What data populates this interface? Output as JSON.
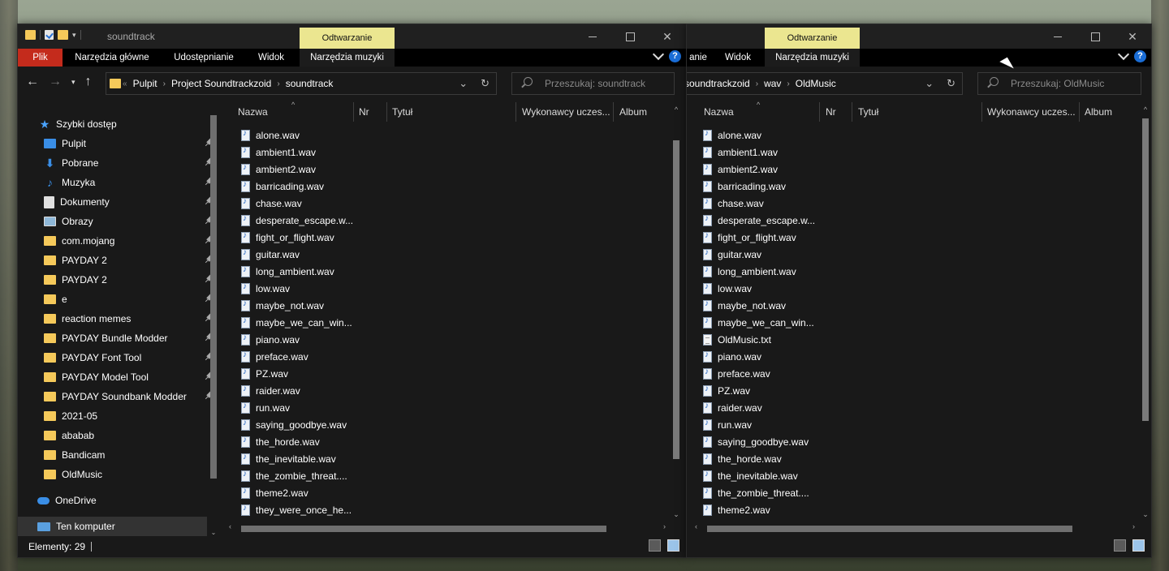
{
  "colors": {
    "file_tab": "#c42b1c",
    "context_tab": "#ebe690",
    "window_bg": "#191919",
    "accent": "#1a6dd6",
    "folder": "#f5c95a"
  },
  "window1": {
    "title": "soundtrack",
    "context_tab": "Odtwarzanie",
    "ribbon_tabs": [
      "Plik",
      "Narzędzia główne",
      "Udostępnianie",
      "Widok",
      "Narzędzia muzyki"
    ],
    "breadcrumb": [
      "Pulpit",
      "Project Soundtrackzoid",
      "soundtrack"
    ],
    "search_placeholder": "Przeszukaj: soundtrack",
    "columns": [
      "Nazwa",
      "Nr",
      "Tytuł",
      "Wykonawcy uczes...",
      "Album"
    ],
    "nav": {
      "quick_access": "Szybki dostęp",
      "items": [
        {
          "label": "Pulpit",
          "icon": "desktop-icon",
          "pinned": true
        },
        {
          "label": "Pobrane",
          "icon": "download-icon",
          "pinned": true
        },
        {
          "label": "Muzyka",
          "icon": "music-icon",
          "pinned": true
        },
        {
          "label": "Dokumenty",
          "icon": "documents-icon",
          "pinned": true
        },
        {
          "label": "Obrazy",
          "icon": "pictures-icon",
          "pinned": true
        },
        {
          "label": "com.mojang",
          "icon": "folder-icon",
          "pinned": true
        },
        {
          "label": "PAYDAY 2",
          "icon": "folder-icon",
          "pinned": true
        },
        {
          "label": "PAYDAY 2",
          "icon": "folder-icon",
          "pinned": true
        },
        {
          "label": "e",
          "icon": "folder-icon",
          "pinned": true
        },
        {
          "label": "reaction memes",
          "icon": "folder-icon",
          "pinned": true
        },
        {
          "label": "PAYDAY Bundle Modder",
          "icon": "folder-icon",
          "pinned": true
        },
        {
          "label": "PAYDAY Font Tool",
          "icon": "folder-icon",
          "pinned": true
        },
        {
          "label": "PAYDAY Model Tool",
          "icon": "folder-icon",
          "pinned": true
        },
        {
          "label": "PAYDAY Soundbank Modder",
          "icon": "folder-icon",
          "pinned": true
        },
        {
          "label": "2021-05",
          "icon": "folder-icon",
          "pinned": false
        },
        {
          "label": "ababab",
          "icon": "folder-icon",
          "pinned": false
        },
        {
          "label": "Bandicam",
          "icon": "folder-icon",
          "pinned": false
        },
        {
          "label": "OldMusic",
          "icon": "folder-icon",
          "pinned": false
        }
      ],
      "onedrive": "OneDrive",
      "this_pc": "Ten komputer"
    },
    "files": [
      "alone.wav",
      "ambient1.wav",
      "ambient2.wav",
      "barricading.wav",
      "chase.wav",
      "desperate_escape.w...",
      "fight_or_flight.wav",
      "guitar.wav",
      "long_ambient.wav",
      "low.wav",
      "maybe_not.wav",
      "maybe_we_can_win...",
      "piano.wav",
      "preface.wav",
      "PZ.wav",
      "raider.wav",
      "run.wav",
      "saying_goodbye.wav",
      "the_horde.wav",
      "the_inevitable.wav",
      "the_zombie_threat....",
      "theme2.wav",
      "they_were_once_he..."
    ],
    "status": "Elementy: 29"
  },
  "window2": {
    "context_tab": "Odtwarzanie",
    "ribbon_tabs": [
      "anie",
      "Widok",
      "Narzędzia muzyki"
    ],
    "breadcrumb": [
      "soundtrackzoid",
      "wav",
      "OldMusic"
    ],
    "search_placeholder": "Przeszukaj: OldMusic",
    "columns": [
      "Nazwa",
      "Nr",
      "Tytuł",
      "Wykonawcy uczes...",
      "Album"
    ],
    "files": [
      {
        "name": "alone.wav",
        "type": "wav"
      },
      {
        "name": "ambient1.wav",
        "type": "wav"
      },
      {
        "name": "ambient2.wav",
        "type": "wav"
      },
      {
        "name": "barricading.wav",
        "type": "wav"
      },
      {
        "name": "chase.wav",
        "type": "wav"
      },
      {
        "name": "desperate_escape.w...",
        "type": "wav"
      },
      {
        "name": "fight_or_flight.wav",
        "type": "wav"
      },
      {
        "name": "guitar.wav",
        "type": "wav"
      },
      {
        "name": "long_ambient.wav",
        "type": "wav"
      },
      {
        "name": "low.wav",
        "type": "wav"
      },
      {
        "name": "maybe_not.wav",
        "type": "wav"
      },
      {
        "name": "maybe_we_can_win...",
        "type": "wav"
      },
      {
        "name": "OldMusic.txt",
        "type": "txt"
      },
      {
        "name": "piano.wav",
        "type": "wav"
      },
      {
        "name": "preface.wav",
        "type": "wav"
      },
      {
        "name": "PZ.wav",
        "type": "wav"
      },
      {
        "name": "raider.wav",
        "type": "wav"
      },
      {
        "name": "run.wav",
        "type": "wav"
      },
      {
        "name": "saying_goodbye.wav",
        "type": "wav"
      },
      {
        "name": "the_horde.wav",
        "type": "wav"
      },
      {
        "name": "the_inevitable.wav",
        "type": "wav"
      },
      {
        "name": "the_zombie_threat....",
        "type": "wav"
      },
      {
        "name": "theme2.wav",
        "type": "wav"
      }
    ]
  }
}
